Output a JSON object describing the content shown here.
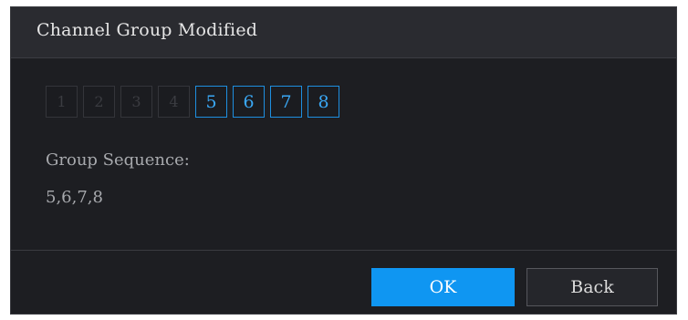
{
  "dialog": {
    "title": "Channel Group Modified"
  },
  "channels": [
    {
      "label": "1",
      "selected": false
    },
    {
      "label": "2",
      "selected": false
    },
    {
      "label": "3",
      "selected": false
    },
    {
      "label": "4",
      "selected": false
    },
    {
      "label": "5",
      "selected": true
    },
    {
      "label": "6",
      "selected": true
    },
    {
      "label": "7",
      "selected": true
    },
    {
      "label": "8",
      "selected": true
    }
  ],
  "group": {
    "sequence_label": "Group Sequence:",
    "sequence_value": "5,6,7,8"
  },
  "buttons": {
    "ok_label": "OK",
    "back_label": "Back"
  },
  "colors": {
    "accent": "#0f96f2",
    "background": "#1d1e22",
    "title_bar": "#2a2b30"
  }
}
